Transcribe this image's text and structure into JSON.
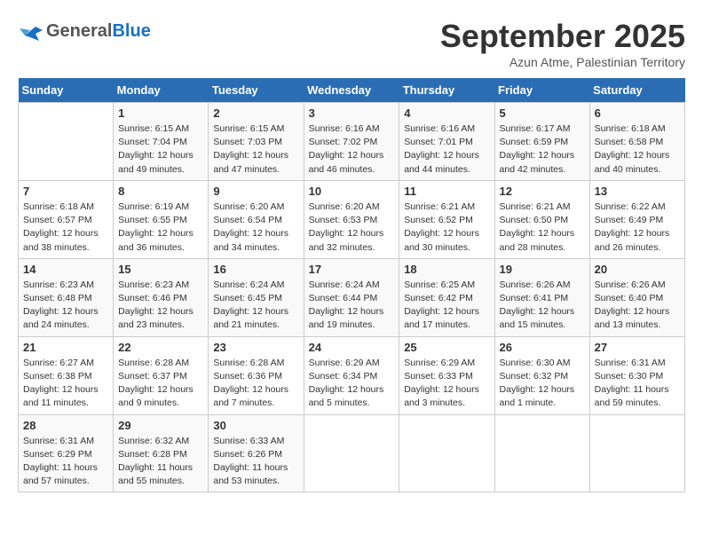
{
  "header": {
    "logo_general": "General",
    "logo_blue": "Blue",
    "month_title": "September 2025",
    "location": "Azun Atme, Palestinian Territory"
  },
  "days_of_week": [
    "Sunday",
    "Monday",
    "Tuesday",
    "Wednesday",
    "Thursday",
    "Friday",
    "Saturday"
  ],
  "weeks": [
    [
      {
        "day": "",
        "info": ""
      },
      {
        "day": "1",
        "info": "Sunrise: 6:15 AM\nSunset: 7:04 PM\nDaylight: 12 hours\nand 49 minutes."
      },
      {
        "day": "2",
        "info": "Sunrise: 6:15 AM\nSunset: 7:03 PM\nDaylight: 12 hours\nand 47 minutes."
      },
      {
        "day": "3",
        "info": "Sunrise: 6:16 AM\nSunset: 7:02 PM\nDaylight: 12 hours\nand 46 minutes."
      },
      {
        "day": "4",
        "info": "Sunrise: 6:16 AM\nSunset: 7:01 PM\nDaylight: 12 hours\nand 44 minutes."
      },
      {
        "day": "5",
        "info": "Sunrise: 6:17 AM\nSunset: 6:59 PM\nDaylight: 12 hours\nand 42 minutes."
      },
      {
        "day": "6",
        "info": "Sunrise: 6:18 AM\nSunset: 6:58 PM\nDaylight: 12 hours\nand 40 minutes."
      }
    ],
    [
      {
        "day": "7",
        "info": "Sunrise: 6:18 AM\nSunset: 6:57 PM\nDaylight: 12 hours\nand 38 minutes."
      },
      {
        "day": "8",
        "info": "Sunrise: 6:19 AM\nSunset: 6:55 PM\nDaylight: 12 hours\nand 36 minutes."
      },
      {
        "day": "9",
        "info": "Sunrise: 6:20 AM\nSunset: 6:54 PM\nDaylight: 12 hours\nand 34 minutes."
      },
      {
        "day": "10",
        "info": "Sunrise: 6:20 AM\nSunset: 6:53 PM\nDaylight: 12 hours\nand 32 minutes."
      },
      {
        "day": "11",
        "info": "Sunrise: 6:21 AM\nSunset: 6:52 PM\nDaylight: 12 hours\nand 30 minutes."
      },
      {
        "day": "12",
        "info": "Sunrise: 6:21 AM\nSunset: 6:50 PM\nDaylight: 12 hours\nand 28 minutes."
      },
      {
        "day": "13",
        "info": "Sunrise: 6:22 AM\nSunset: 6:49 PM\nDaylight: 12 hours\nand 26 minutes."
      }
    ],
    [
      {
        "day": "14",
        "info": "Sunrise: 6:23 AM\nSunset: 6:48 PM\nDaylight: 12 hours\nand 24 minutes."
      },
      {
        "day": "15",
        "info": "Sunrise: 6:23 AM\nSunset: 6:46 PM\nDaylight: 12 hours\nand 23 minutes."
      },
      {
        "day": "16",
        "info": "Sunrise: 6:24 AM\nSunset: 6:45 PM\nDaylight: 12 hours\nand 21 minutes."
      },
      {
        "day": "17",
        "info": "Sunrise: 6:24 AM\nSunset: 6:44 PM\nDaylight: 12 hours\nand 19 minutes."
      },
      {
        "day": "18",
        "info": "Sunrise: 6:25 AM\nSunset: 6:42 PM\nDaylight: 12 hours\nand 17 minutes."
      },
      {
        "day": "19",
        "info": "Sunrise: 6:26 AM\nSunset: 6:41 PM\nDaylight: 12 hours\nand 15 minutes."
      },
      {
        "day": "20",
        "info": "Sunrise: 6:26 AM\nSunset: 6:40 PM\nDaylight: 12 hours\nand 13 minutes."
      }
    ],
    [
      {
        "day": "21",
        "info": "Sunrise: 6:27 AM\nSunset: 6:38 PM\nDaylight: 12 hours\nand 11 minutes."
      },
      {
        "day": "22",
        "info": "Sunrise: 6:28 AM\nSunset: 6:37 PM\nDaylight: 12 hours\nand 9 minutes."
      },
      {
        "day": "23",
        "info": "Sunrise: 6:28 AM\nSunset: 6:36 PM\nDaylight: 12 hours\nand 7 minutes."
      },
      {
        "day": "24",
        "info": "Sunrise: 6:29 AM\nSunset: 6:34 PM\nDaylight: 12 hours\nand 5 minutes."
      },
      {
        "day": "25",
        "info": "Sunrise: 6:29 AM\nSunset: 6:33 PM\nDaylight: 12 hours\nand 3 minutes."
      },
      {
        "day": "26",
        "info": "Sunrise: 6:30 AM\nSunset: 6:32 PM\nDaylight: 12 hours\nand 1 minute."
      },
      {
        "day": "27",
        "info": "Sunrise: 6:31 AM\nSunset: 6:30 PM\nDaylight: 11 hours\nand 59 minutes."
      }
    ],
    [
      {
        "day": "28",
        "info": "Sunrise: 6:31 AM\nSunset: 6:29 PM\nDaylight: 11 hours\nand 57 minutes."
      },
      {
        "day": "29",
        "info": "Sunrise: 6:32 AM\nSunset: 6:28 PM\nDaylight: 11 hours\nand 55 minutes."
      },
      {
        "day": "30",
        "info": "Sunrise: 6:33 AM\nSunset: 6:26 PM\nDaylight: 11 hours\nand 53 minutes."
      },
      {
        "day": "",
        "info": ""
      },
      {
        "day": "",
        "info": ""
      },
      {
        "day": "",
        "info": ""
      },
      {
        "day": "",
        "info": ""
      }
    ]
  ]
}
